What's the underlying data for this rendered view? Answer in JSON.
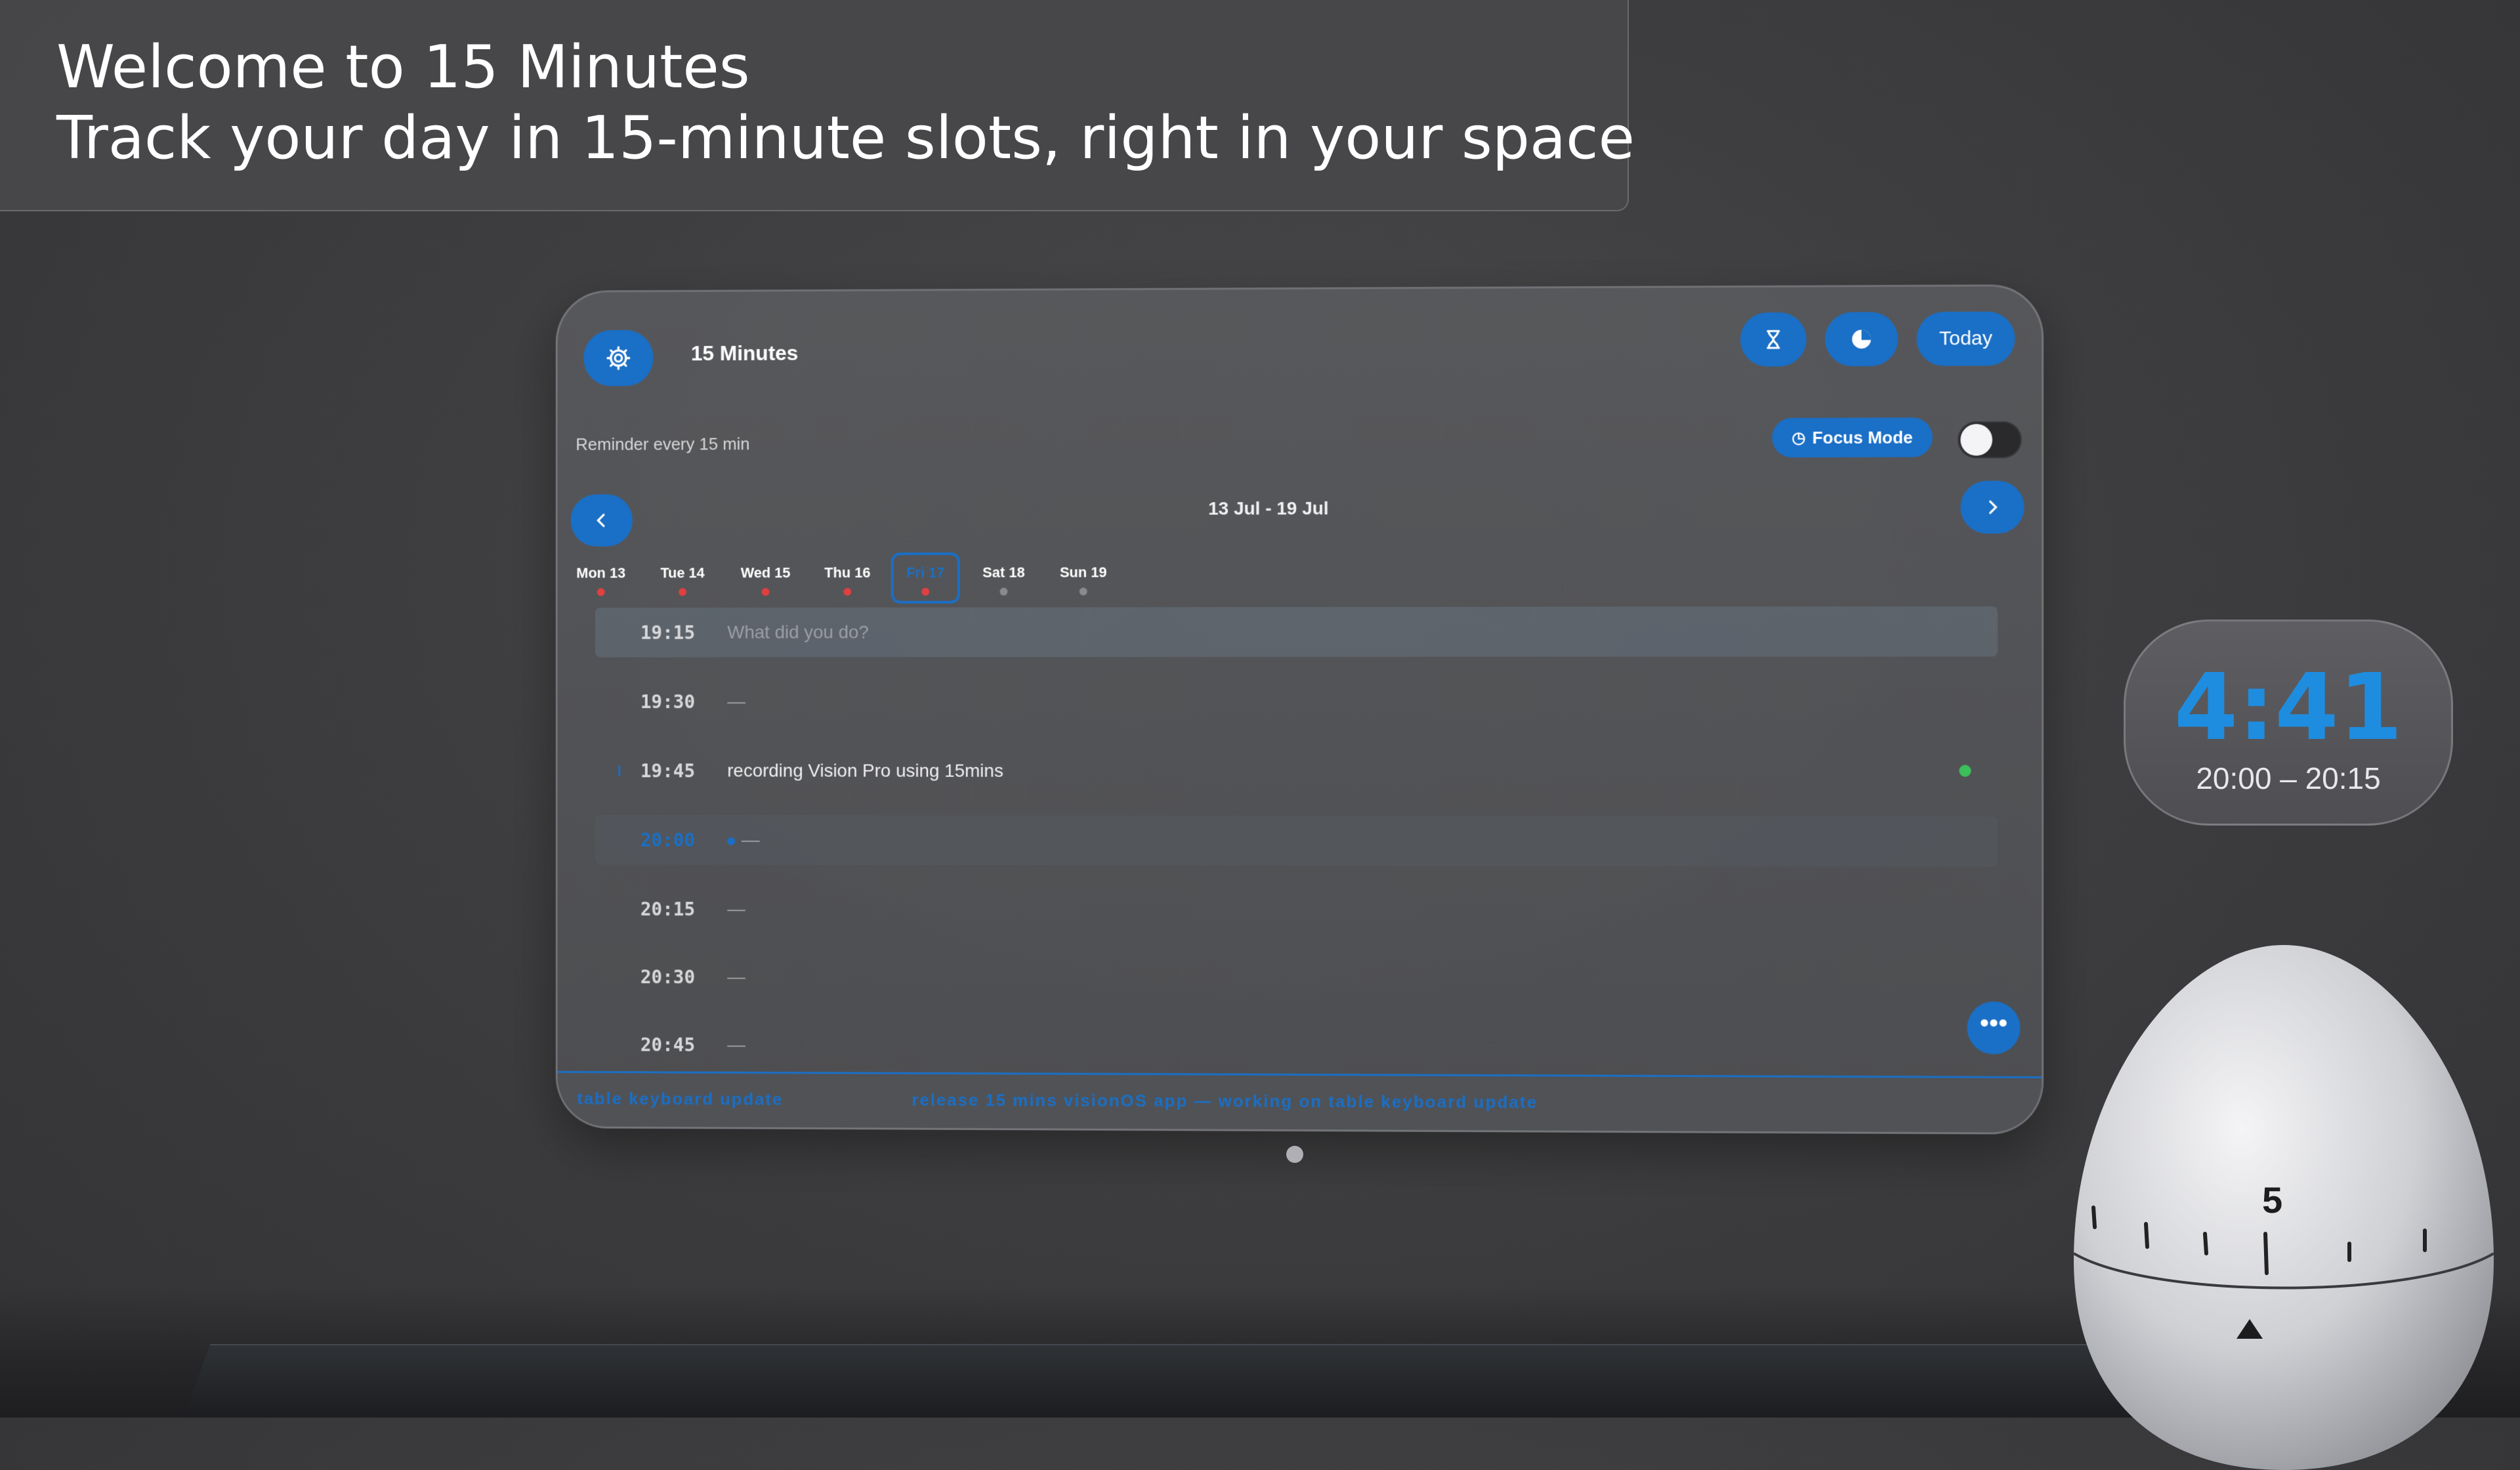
{
  "banner": {
    "line1": "Welcome to 15 Minutes",
    "line2": "Track your day in 15-minute slots, right in your space"
  },
  "app": {
    "title": "15 Minutes",
    "reminder": "Reminder every 15 min",
    "today_label": "Today",
    "focus_mode_label": "Focus Mode",
    "focus_mode_on": false,
    "week_range": "13 Jul - 19 Jul",
    "days": [
      {
        "label": "Mon 13",
        "dot": "#e04040"
      },
      {
        "label": "Tue 14",
        "dot": "#e04040"
      },
      {
        "label": "Wed 15",
        "dot": "#e04040"
      },
      {
        "label": "Thu 16",
        "dot": "#e04040"
      },
      {
        "label": "Fri 17",
        "dot": "#e04040",
        "selected": true
      },
      {
        "label": "Sat 18",
        "dot": "#8a8a8e"
      },
      {
        "label": "Sun 19",
        "dot": "#8a8a8e"
      }
    ],
    "slots": [
      {
        "time": "19:15",
        "text": "What did you do?"
      },
      {
        "time": "19:30",
        "text": "—"
      },
      {
        "time": "19:45",
        "text": "recording Vision Pro using 15mins"
      },
      {
        "time": "20:00",
        "text": "—"
      },
      {
        "time": "20:15",
        "text": "—"
      },
      {
        "time": "20:30",
        "text": "—"
      },
      {
        "time": "20:45",
        "text": "—"
      }
    ],
    "footer": {
      "left": "table keyboard update",
      "right": "release 15 mins visionOS app  —  working on table keyboard update"
    }
  },
  "timer_widget": {
    "remaining": "4:41",
    "range": "20:00 – 20:15"
  },
  "colors": {
    "accent": "#1a6fc6",
    "timer_accent": "#1e8de0",
    "done_green": "#3cc05a",
    "day_dot_red": "#e04040"
  },
  "egg_timer": {
    "dial_number": "5"
  }
}
